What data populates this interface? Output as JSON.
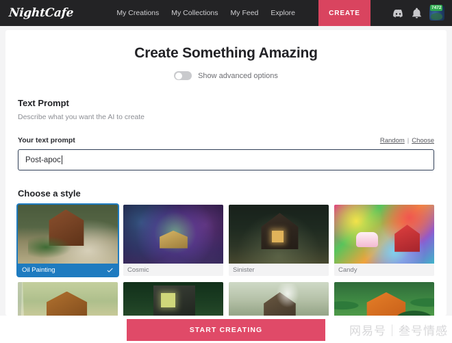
{
  "header": {
    "logo_text": "NightCafe",
    "nav": [
      {
        "label": "My Creations"
      },
      {
        "label": "My Collections"
      },
      {
        "label": "My Feed"
      },
      {
        "label": "Explore"
      }
    ],
    "create_label": "CREATE",
    "discord_icon": "discord-icon",
    "bell_icon": "bell-icon",
    "avatar_badge": "7472"
  },
  "main": {
    "heading": "Create Something Amazing",
    "advanced_toggle_label": "Show advanced options",
    "advanced_toggle_state": "off",
    "text_prompt": {
      "title": "Text Prompt",
      "subtitle": "Describe what you want the AI to create",
      "field_label": "Your text prompt",
      "random_link": "Random",
      "separator": "|",
      "choose_link": "Choose",
      "value": "Post-apoc",
      "placeholder": "Your text prompt"
    },
    "style_section": {
      "title": "Choose a style",
      "row1": [
        {
          "label": "Oil Painting",
          "selected": true,
          "art": "art-oil"
        },
        {
          "label": "Cosmic",
          "selected": false,
          "art": "art-cosmic"
        },
        {
          "label": "Sinister",
          "selected": false,
          "art": "art-sinister"
        },
        {
          "label": "Candy",
          "selected": false,
          "art": "art-candy"
        }
      ],
      "row2": [
        {
          "label": "",
          "selected": false,
          "art": "art-paper"
        },
        {
          "label": "",
          "selected": false,
          "art": "art-dark-forest"
        },
        {
          "label": "",
          "selected": false,
          "art": "art-mist"
        },
        {
          "label": "",
          "selected": false,
          "art": "art-vivid"
        }
      ]
    }
  },
  "footer": {
    "start_label": "START CREATING",
    "watermark": "网易号｜叁号情感"
  },
  "colors": {
    "header_bg": "#232325",
    "create_pink": "#d9445f",
    "start_pink": "#e04a68",
    "selected_blue": "#1e7bc0",
    "badge_green": "#2fa84f",
    "input_border": "#2f3e56"
  }
}
